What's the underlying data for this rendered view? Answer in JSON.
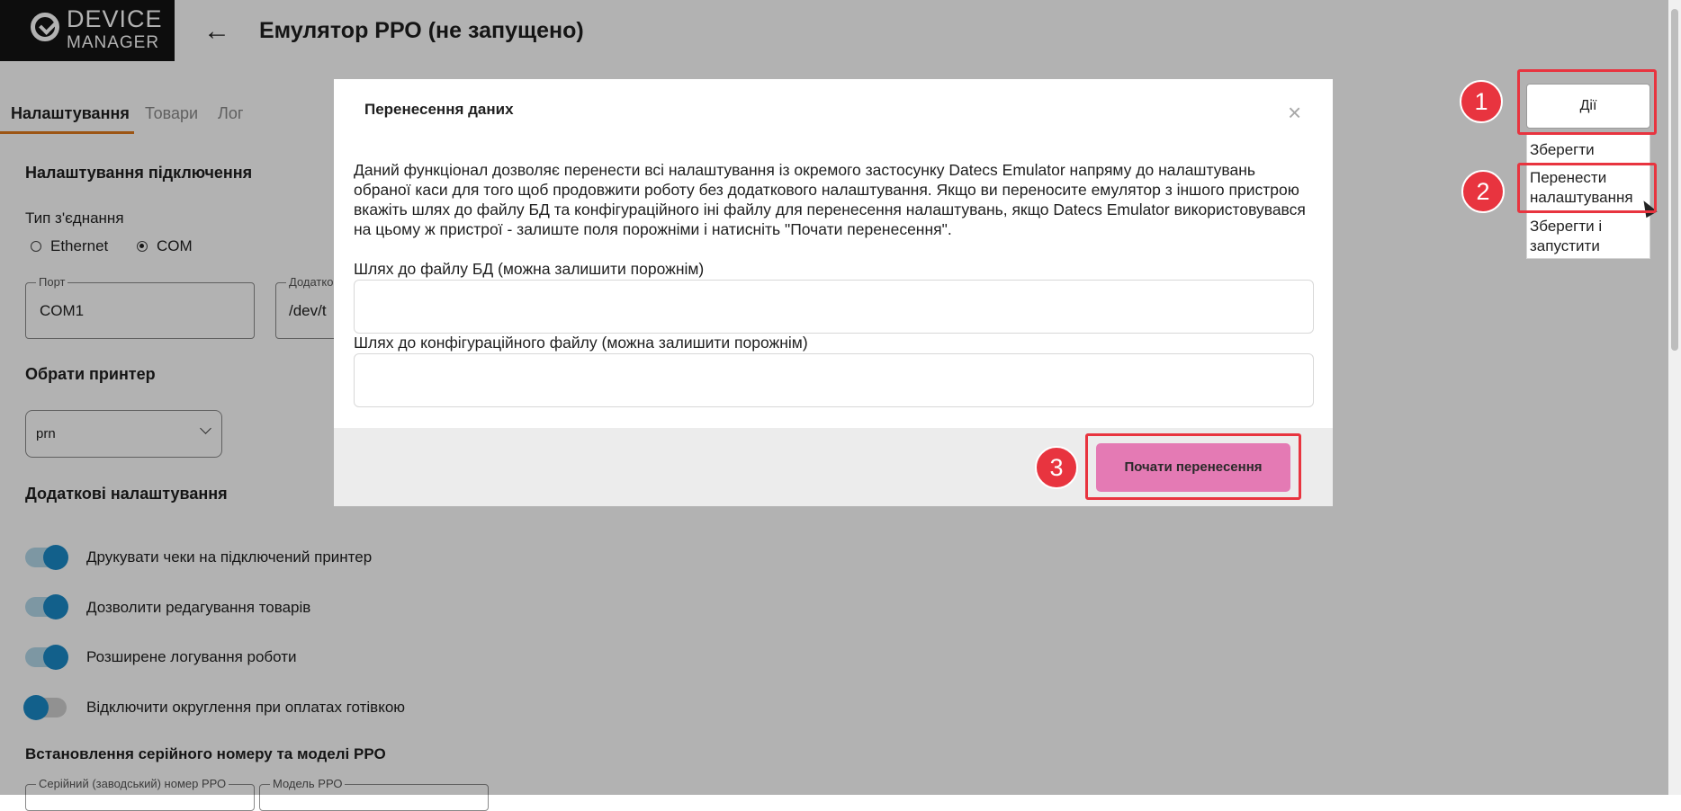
{
  "header": {
    "logo_line1": "DEVICE",
    "logo_line2": "MANAGER",
    "back_icon": "arrow-left-icon",
    "title": "Емулятор РРО (не запущено)"
  },
  "tabs": [
    {
      "label": "Налаштування",
      "active": true
    },
    {
      "label": "Товари",
      "active": false
    },
    {
      "label": "Лог",
      "active": false
    }
  ],
  "settings": {
    "connection_heading": "Налаштування підключення",
    "connection_type_label": "Тип з'єднання",
    "radio_ethernet": "Ethernet",
    "radio_com": "COM",
    "port_legend": "Порт",
    "port_value": "COM1",
    "extra_legend": "Додатко",
    "extra_value": "/dev/t",
    "printer_heading": "Обрати принтер",
    "printer_value": "prn",
    "additional_heading": "Додаткові налаштування",
    "toggles": [
      {
        "label": "Друкувати чеки на підключений принтер",
        "on": true
      },
      {
        "label": "Дозволити редагування товарів",
        "on": true
      },
      {
        "label": "Розширене логування роботи",
        "on": true
      },
      {
        "label": "Відключити округлення при оплатах готівкою",
        "on": false
      }
    ],
    "serial_heading": "Встановлення серійного номеру та моделі РРО",
    "serial_legend": "Серійний (заводський) номер РРО",
    "model_legend": "Модель РРО"
  },
  "actions": {
    "button_label": "Дії",
    "menu": [
      "Зберегти",
      "Перенести налаштування",
      "Зберегти і запустити"
    ]
  },
  "modal": {
    "title": "Перенесення даних",
    "description": "Даний функціонал дозволяє перенести всі налаштування із окремого застосунку Datecs Emulator напряму до налаштувань обраної каси для того щоб продовжити роботу без додаткового налаштування. Якщо ви переносите емулятор з іншого пристрою вкажіть шлях до файлу БД та конфігураційного іні файлу для перенесення налаштувань, якщо Datecs Emulator використовувався на цьому ж пристрої - залиште поля порожніми і натисніть \"Почати перенесення\".",
    "db_path_label": "Шлях до файлу БД (можна залишити порожнім)",
    "db_path_value": "",
    "config_path_label": "Шлях до конфігураційного файлу (можна залишити порожнім)",
    "config_path_value": "",
    "start_button": "Почати перенесення"
  },
  "annotations": [
    "1",
    "2",
    "3"
  ],
  "colors": {
    "accent_tab": "#e07a1e",
    "toggle_on": "#1a8ac7",
    "primary_button": "#e47ab4",
    "annotation_red": "#e8343f"
  }
}
